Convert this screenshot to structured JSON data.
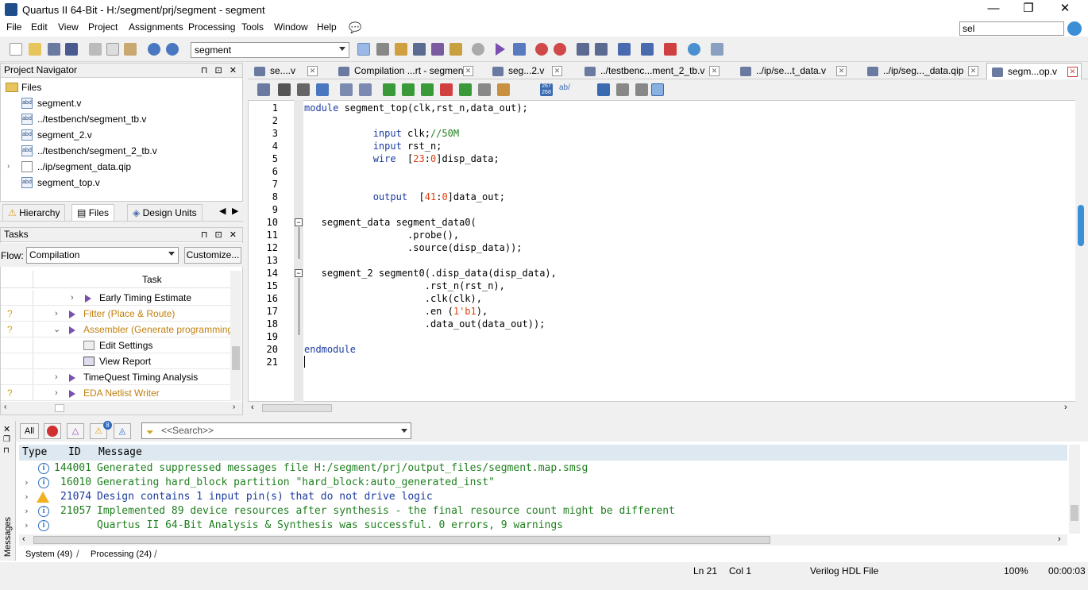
{
  "window": {
    "title": "Quartus II 64-Bit - H:/segment/prj/segment - segment",
    "controls": [
      "—",
      "❐",
      "✕"
    ]
  },
  "menu": [
    "File",
    "Edit",
    "View",
    "Project",
    "Assignments",
    "Processing",
    "Tools",
    "Window",
    "Help"
  ],
  "search": {
    "value": "sel"
  },
  "toolbar": {
    "project_combo": "segment"
  },
  "project_navigator": {
    "title": "Project Navigator",
    "root": "Files",
    "files": [
      {
        "name": "segment.v",
        "type": "abd"
      },
      {
        "name": "../testbench/segment_tb.v",
        "type": "abd"
      },
      {
        "name": "segment_2.v",
        "type": "abd"
      },
      {
        "name": "../testbench/segment_2_tb.v",
        "type": "abd"
      },
      {
        "name": "../ip/segment_data.qip",
        "type": "doc"
      },
      {
        "name": "segment_top.v",
        "type": "abd"
      }
    ],
    "tabs": [
      "Hierarchy",
      "Files",
      "Design Units"
    ],
    "ctrl_icons": "⊓ ⊡ ✕"
  },
  "tasks": {
    "title": "Tasks",
    "flow_label": "Flow:",
    "flow_value": "Compilation",
    "customize_label": "Customize...",
    "column_header": "Task",
    "rows": [
      {
        "label": "Early Timing Estimate",
        "status": "",
        "indent": 1,
        "color": "#000000"
      },
      {
        "label": "Fitter (Place & Route)",
        "status": "?",
        "indent": 0,
        "color": "#c08010"
      },
      {
        "label": "Assembler (Generate programming file",
        "status": "?",
        "indent": 0,
        "color": "#c08010",
        "expanded": true
      },
      {
        "label": "Edit Settings",
        "status": "",
        "indent": 2,
        "color": "#000000"
      },
      {
        "label": "View Report",
        "status": "",
        "indent": 2,
        "color": "#000000"
      },
      {
        "label": "TimeQuest Timing Analysis",
        "status": "",
        "indent": 0,
        "color": "#000000"
      },
      {
        "label": "EDA Netlist Writer",
        "status": "?",
        "indent": 0,
        "color": "#c08010"
      }
    ]
  },
  "editor_tabs": [
    {
      "label": "se....v"
    },
    {
      "label": "Compilation ...rt - segment"
    },
    {
      "label": "seg...2.v"
    },
    {
      "label": "../testbenc...ment_2_tb.v"
    },
    {
      "label": "../ip/se...t_data.v"
    },
    {
      "label": "../ip/seg..._data.qip"
    },
    {
      "label": "segm...op.v",
      "active": true
    }
  ],
  "editor": {
    "lines": [
      {
        "n": "1",
        "code": "module segment_top(clk,rst_n,data_out);"
      },
      {
        "n": "2",
        "code": ""
      },
      {
        "n": "3",
        "code": "            input clk;//50M"
      },
      {
        "n": "4",
        "code": "            input rst_n;"
      },
      {
        "n": "5",
        "code": "            wire  [23:0]disp_data;"
      },
      {
        "n": "6",
        "code": ""
      },
      {
        "n": "7",
        "code": ""
      },
      {
        "n": "8",
        "code": "            output  [41:0]data_out;"
      },
      {
        "n": "9",
        "code": ""
      },
      {
        "n": "10",
        "code": "   segment_data segment_data0("
      },
      {
        "n": "11",
        "code": "                  .probe(),"
      },
      {
        "n": "12",
        "code": "                  .source(disp_data));"
      },
      {
        "n": "13",
        "code": ""
      },
      {
        "n": "14",
        "code": "   segment_2 segment0(.disp_data(disp_data),"
      },
      {
        "n": "15",
        "code": "                     .rst_n(rst_n),"
      },
      {
        "n": "16",
        "code": "                     .clk(clk),"
      },
      {
        "n": "17",
        "code": "                     .en (1'b1),"
      },
      {
        "n": "18",
        "code": "                     .data_out(data_out));"
      },
      {
        "n": "19",
        "code": ""
      },
      {
        "n": "20",
        "code": "endmodule"
      },
      {
        "n": "21",
        "code": ""
      }
    ]
  },
  "messages": {
    "side_label": "Messages",
    "filter_all": "All",
    "warn_badge": "8",
    "search_placeholder": "<<Search>>",
    "headers": {
      "type": "Type",
      "id": "ID",
      "message": "Message"
    },
    "rows": [
      {
        "icon": "info",
        "id": "144001",
        "text": "Generated suppressed messages file H:/segment/prj/output_files/segment.map.smsg",
        "color": "#208020",
        "expand": false
      },
      {
        "icon": "info",
        "id": "16010",
        "text": "Generating hard_block partition \"hard_block:auto_generated_inst\"",
        "color": "#208020",
        "expand": true
      },
      {
        "icon": "warning",
        "id": "21074",
        "text": "Design contains 1 input pin(s) that do not drive logic",
        "color": "#1c3ba0",
        "expand": true
      },
      {
        "icon": "info",
        "id": "21057",
        "text": "Implemented 89 device resources after synthesis - the final resource count might be different",
        "color": "#208020",
        "expand": true
      },
      {
        "icon": "info",
        "id": "",
        "text": "Quartus II 64-Bit Analysis & Synthesis was successful. 0 errors, 9 warnings",
        "color": "#208020",
        "expand": true
      }
    ],
    "bottom_tabs": [
      "System (49)",
      "Processing (24)"
    ]
  },
  "status": {
    "ln": "Ln 21",
    "col": "Col 1",
    "file_type": "Verilog HDL File",
    "zoom": "100%",
    "elapsed": "00:00:03"
  }
}
